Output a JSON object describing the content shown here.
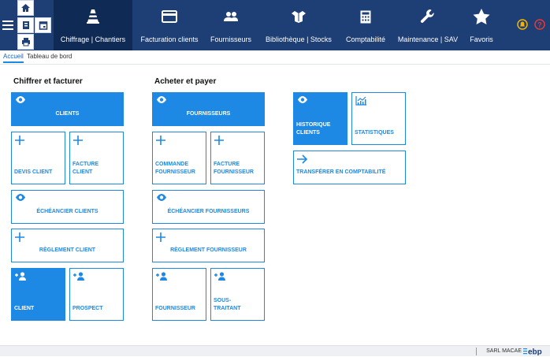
{
  "nav": {
    "items": [
      {
        "label": "Chiffrage | Chantiers",
        "icon": "cone-icon"
      },
      {
        "label": "Facturation clients",
        "icon": "credit-card-icon"
      },
      {
        "label": "Fournisseurs",
        "icon": "people-icon"
      },
      {
        "label": "Bibliothèque | Stocks",
        "icon": "boxes-icon"
      },
      {
        "label": "Comptabilité",
        "icon": "calculator-icon"
      },
      {
        "label": "Maintenance | SAV",
        "icon": "wrench-icon"
      },
      {
        "label": "Favoris",
        "icon": "star-icon"
      }
    ]
  },
  "tabs": [
    "Accueil",
    "Tableau de bord"
  ],
  "sections": {
    "left": "Chiffrer et facturer",
    "middle": "Acheter et payer"
  },
  "tiles": {
    "clients": "CLIENTS",
    "devis_client": "DEVIS CLIENT",
    "facture_client": "FACTURE CLIENT",
    "echeancier_clients": "ÉCHÉANCIER CLIENTS",
    "reglement_client": "RÈGLEMENT CLIENT",
    "client": "CLIENT",
    "prospect": "PROSPECT",
    "fournisseurs": "FOURNISSEURS",
    "commande_fournisseur": "COMMANDE FOURNISSEUR",
    "facture_fournisseur": "FACTURE FOURNISSEUR",
    "echeancier_fournisseurs": "ÉCHÉANCIER FOURNISSEURS",
    "reglement_fournisseur": "RÈGLEMENT FOURNISSEUR",
    "fournisseur": "FOURNISSEUR",
    "sous_traitant": "SOUS-TRAITANT",
    "historique_clients": "HISTORIQUE CLIENTS",
    "statistiques": "STATISTIQUES",
    "transferer": "TRANSFÉRER EN COMPTABILITÉ"
  },
  "footer": {
    "company": "SARL MACAE",
    "brand": "ebp"
  },
  "colors": {
    "topbar": "#1e3f75",
    "accent": "#1e88e5",
    "active_nav": "#0f2a55"
  }
}
